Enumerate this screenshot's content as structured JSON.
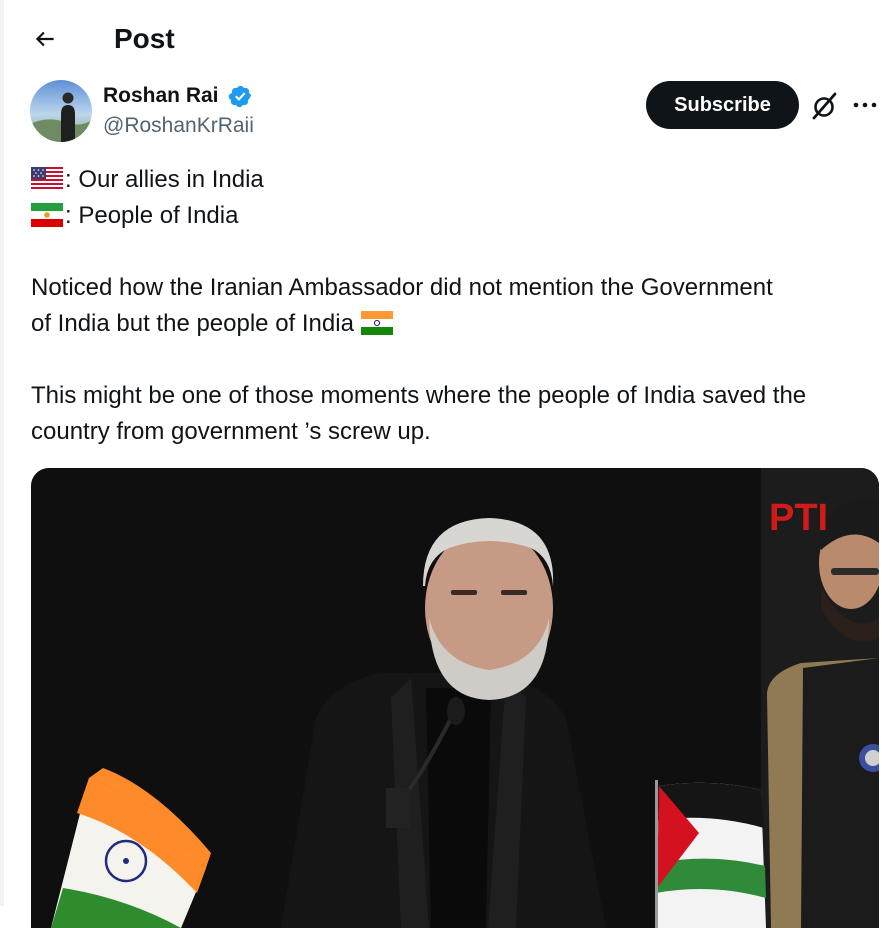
{
  "header": {
    "title": "Post"
  },
  "author": {
    "name": "Roshan Rai",
    "handle": "@RoshanKrRaii"
  },
  "actions": {
    "subscribe_label": "Subscribe"
  },
  "tweet": {
    "line1": ": Our allies in India",
    "line2": ": People of India",
    "para1_line1": "Noticed how the Iranian Ambassador did not mention the Government",
    "para1_line2": "of India but the people of India",
    "para2_line1": "This might be one of those moments where the people of India saved the",
    "para2_line2": "country from government ’s screw up."
  },
  "media": {
    "watermark": "PTI"
  },
  "icons": {
    "back": "arrow-left-icon",
    "verified": "verified-badge-icon",
    "grok": "grok-icon",
    "more": "more-horizontal-icon",
    "flags": [
      "us-flag-icon",
      "iran-flag-icon",
      "india-flag-icon"
    ]
  },
  "colors": {
    "verified": "#1d9bf0",
    "text": "#0f1419",
    "secondary": "#536471",
    "button": "#0f1419"
  }
}
